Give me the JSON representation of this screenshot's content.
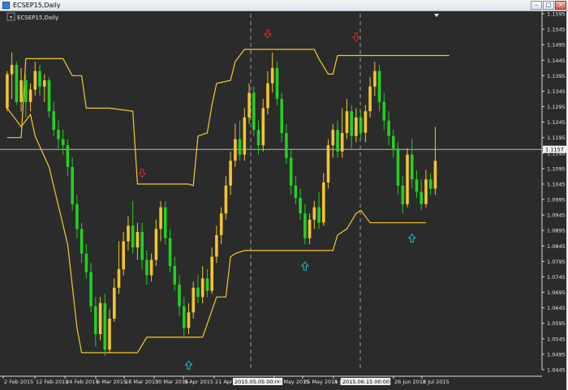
{
  "window": {
    "title": "ECSEP15,Daily",
    "min_glyph": "–",
    "max_glyph": "□",
    "close_glyph": "×"
  },
  "chart_label": "ECSEP15,Daily",
  "colors": {
    "bg": "#2b2b2b",
    "bull": "#f4c430",
    "bear": "#22d022",
    "channel": "#f7c82e",
    "hline": "#b9b9b9",
    "vline": "#9a9a9a",
    "axis_text": "#e6e6e6",
    "up_arrow": "#22c0c0",
    "down_arrow": "#dd2b2b"
  },
  "chart_data": {
    "type": "candlestick",
    "y_axis": {
      "min": 1.0445,
      "max": 1.1595,
      "ticks": [
        "1.1595",
        "1.1545",
        "1.1495",
        "1.1445",
        "1.1395",
        "1.1345",
        "1.1295",
        "1.1245",
        "1.1195",
        "1.1145",
        "1.1095",
        "1.1045",
        "1.0995",
        "1.0945",
        "1.0895",
        "1.0845",
        "1.0795",
        "1.0745",
        "1.0695",
        "1.0645",
        "1.0595",
        "1.0545",
        "1.0495",
        "1.0445"
      ]
    },
    "x_axis": {
      "labels": [
        "2 Feb 2015",
        "12 Feb 2015",
        "24 Feb 2015",
        "6 Mar 2015",
        "18 Mar 2015",
        "30 Mar 2015",
        "9 Apr 2015",
        "21 Apr 2015",
        "2015.05.05 00:00",
        "13 May 2015",
        "25 May 2015",
        "4 Jun",
        "2015.06.15 00:00",
        "26 Jun 2015",
        "8 Jul 2015"
      ],
      "highlighted": [
        "2015.05.05 00:00",
        "2015.06.15 00:00"
      ]
    },
    "current_price": "1.1157",
    "vertical_markers": [
      "2015.05.05 00:00",
      "2015.06.15 00:00"
    ],
    "candles": [
      [
        1.129,
        1.14,
        1.141,
        1.128
      ],
      [
        1.14,
        1.143,
        1.147,
        1.132
      ],
      [
        1.143,
        1.131,
        1.144,
        1.13
      ],
      [
        1.131,
        1.138,
        1.142,
        1.128
      ],
      [
        1.138,
        1.131,
        1.14,
        1.126
      ],
      [
        1.131,
        1.135,
        1.137,
        1.128
      ],
      [
        1.135,
        1.141,
        1.144,
        1.133
      ],
      [
        1.141,
        1.136,
        1.143,
        1.133
      ],
      [
        1.136,
        1.138,
        1.14,
        1.131
      ],
      [
        1.138,
        1.128,
        1.139,
        1.126
      ],
      [
        1.128,
        1.122,
        1.131,
        1.12
      ],
      [
        1.122,
        1.119,
        1.125,
        1.116
      ],
      [
        1.119,
        1.117,
        1.122,
        1.114
      ],
      [
        1.117,
        1.11,
        1.119,
        1.107
      ],
      [
        1.11,
        1.098,
        1.113,
        1.096
      ],
      [
        1.098,
        1.09,
        1.101,
        1.087
      ],
      [
        1.09,
        1.082,
        1.092,
        1.079
      ],
      [
        1.082,
        1.076,
        1.085,
        1.074
      ],
      [
        1.076,
        1.065,
        1.079,
        1.063
      ],
      [
        1.065,
        1.056,
        1.068,
        1.052
      ],
      [
        1.056,
        1.066,
        1.068,
        1.054
      ],
      [
        1.066,
        1.051,
        1.069,
        1.049
      ],
      [
        1.051,
        1.061,
        1.064,
        1.05
      ],
      [
        1.061,
        1.071,
        1.074,
        1.06
      ],
      [
        1.071,
        1.077,
        1.086,
        1.069
      ],
      [
        1.077,
        1.086,
        1.089,
        1.075
      ],
      [
        1.086,
        1.091,
        1.094,
        1.083
      ],
      [
        1.091,
        1.084,
        1.099,
        1.082
      ],
      [
        1.084,
        1.089,
        1.092,
        1.08
      ],
      [
        1.089,
        1.08,
        1.092,
        1.077
      ],
      [
        1.08,
        1.075,
        1.083,
        1.072
      ],
      [
        1.075,
        1.08,
        1.082,
        1.073
      ],
      [
        1.08,
        1.09,
        1.093,
        1.078
      ],
      [
        1.09,
        1.097,
        1.099,
        1.086
      ],
      [
        1.097,
        1.087,
        1.099,
        1.085
      ],
      [
        1.087,
        1.078,
        1.09,
        1.076
      ],
      [
        1.078,
        1.072,
        1.081,
        1.07
      ],
      [
        1.072,
        1.065,
        1.075,
        1.062
      ],
      [
        1.065,
        1.058,
        1.068,
        1.055
      ],
      [
        1.058,
        1.063,
        1.066,
        1.056
      ],
      [
        1.063,
        1.071,
        1.073,
        1.061
      ],
      [
        1.071,
        1.068,
        1.075,
        1.066
      ],
      [
        1.068,
        1.074,
        1.078,
        1.066
      ],
      [
        1.074,
        1.07,
        1.077,
        1.068
      ],
      [
        1.07,
        1.081,
        1.084,
        1.069
      ],
      [
        1.081,
        1.088,
        1.091,
        1.079
      ],
      [
        1.088,
        1.095,
        1.097,
        1.085
      ],
      [
        1.095,
        1.104,
        1.107,
        1.093
      ],
      [
        1.104,
        1.112,
        1.115,
        1.101
      ],
      [
        1.112,
        1.119,
        1.124,
        1.11
      ],
      [
        1.119,
        1.114,
        1.125,
        1.112
      ],
      [
        1.114,
        1.126,
        1.129,
        1.112
      ],
      [
        1.126,
        1.134,
        1.137,
        1.124
      ],
      [
        1.134,
        1.122,
        1.136,
        1.12
      ],
      [
        1.122,
        1.117,
        1.125,
        1.114
      ],
      [
        1.117,
        1.129,
        1.132,
        1.115
      ],
      [
        1.129,
        1.137,
        1.141,
        1.127
      ],
      [
        1.137,
        1.142,
        1.147,
        1.134
      ],
      [
        1.142,
        1.132,
        1.144,
        1.13
      ],
      [
        1.132,
        1.121,
        1.134,
        1.118
      ],
      [
        1.121,
        1.113,
        1.124,
        1.111
      ],
      [
        1.113,
        1.104,
        1.116,
        1.101
      ],
      [
        1.104,
        1.1,
        1.107,
        1.098
      ],
      [
        1.1,
        1.095,
        1.103,
        1.093
      ],
      [
        1.095,
        1.087,
        1.098,
        1.085
      ],
      [
        1.087,
        1.093,
        1.095,
        1.085
      ],
      [
        1.093,
        1.097,
        1.099,
        1.09
      ],
      [
        1.097,
        1.092,
        1.102,
        1.09
      ],
      [
        1.092,
        1.105,
        1.108,
        1.091
      ],
      [
        1.105,
        1.117,
        1.119,
        1.103
      ],
      [
        1.117,
        1.122,
        1.124,
        1.113
      ],
      [
        1.122,
        1.115,
        1.125,
        1.113
      ],
      [
        1.115,
        1.121,
        1.129,
        1.113
      ],
      [
        1.121,
        1.128,
        1.132,
        1.119
      ],
      [
        1.128,
        1.12,
        1.13,
        1.116
      ],
      [
        1.12,
        1.126,
        1.129,
        1.118
      ],
      [
        1.126,
        1.121,
        1.128,
        1.119
      ],
      [
        1.121,
        1.128,
        1.13,
        1.118
      ],
      [
        1.128,
        1.136,
        1.139,
        1.126
      ],
      [
        1.136,
        1.141,
        1.144,
        1.133
      ],
      [
        1.141,
        1.131,
        1.143,
        1.128
      ],
      [
        1.131,
        1.125,
        1.134,
        1.122
      ],
      [
        1.125,
        1.12,
        1.128,
        1.117
      ],
      [
        1.12,
        1.116,
        1.122,
        1.113
      ],
      [
        1.116,
        1.104,
        1.118,
        1.101
      ],
      [
        1.104,
        1.098,
        1.107,
        1.095
      ],
      [
        1.098,
        1.114,
        1.116,
        1.097
      ],
      [
        1.114,
        1.106,
        1.119,
        1.103
      ],
      [
        1.106,
        1.102,
        1.109,
        1.1
      ],
      [
        1.102,
        1.098,
        1.106,
        1.096
      ],
      [
        1.098,
        1.106,
        1.109,
        1.097
      ],
      [
        1.106,
        1.103,
        1.108,
        1.101
      ],
      [
        1.103,
        1.112,
        1.123,
        1.101
      ]
    ],
    "channel_upper": [
      [
        0,
        1.1195
      ],
      [
        3,
        1.1195
      ],
      [
        4,
        1.145
      ],
      [
        12,
        1.145
      ],
      [
        14,
        1.1395
      ],
      [
        16,
        1.1395
      ],
      [
        17,
        1.129
      ],
      [
        22,
        1.129
      ],
      [
        27,
        1.128
      ],
      [
        28,
        1.1045
      ],
      [
        39,
        1.1045
      ],
      [
        40,
        1.104
      ],
      [
        41,
        1.12
      ],
      [
        43,
        1.121
      ],
      [
        44,
        1.13
      ],
      [
        45,
        1.137
      ],
      [
        48,
        1.138
      ],
      [
        49,
        1.144
      ],
      [
        51,
        1.148
      ],
      [
        66,
        1.148
      ],
      [
        67,
        1.145
      ],
      [
        69,
        1.14
      ],
      [
        70,
        1.14
      ],
      [
        71,
        1.146
      ],
      [
        95,
        1.146
      ]
    ],
    "channel_lower": [
      [
        0,
        1.129
      ],
      [
        3,
        1.123
      ],
      [
        5,
        1.127
      ],
      [
        6,
        1.12
      ],
      [
        9,
        1.11
      ],
      [
        13,
        1.085
      ],
      [
        15,
        1.058
      ],
      [
        16,
        1.05
      ],
      [
        28,
        1.05
      ],
      [
        30,
        1.055
      ],
      [
        42,
        1.055
      ],
      [
        45,
        1.068
      ],
      [
        47,
        1.068
      ],
      [
        48,
        1.081
      ],
      [
        49,
        1.082
      ],
      [
        51,
        1.083
      ],
      [
        55,
        1.083
      ],
      [
        70,
        1.083
      ],
      [
        71,
        1.088
      ],
      [
        73,
        1.09
      ],
      [
        75,
        1.095
      ],
      [
        76,
        1.096
      ],
      [
        78,
        1.092
      ],
      [
        90,
        1.092
      ]
    ],
    "up_arrows": [
      [
        39,
        1.046
      ],
      [
        64,
        1.078
      ],
      [
        87,
        1.087
      ]
    ],
    "down_arrows": [
      [
        29,
        1.108
      ],
      [
        56,
        1.153
      ],
      [
        75,
        1.152
      ]
    ]
  }
}
